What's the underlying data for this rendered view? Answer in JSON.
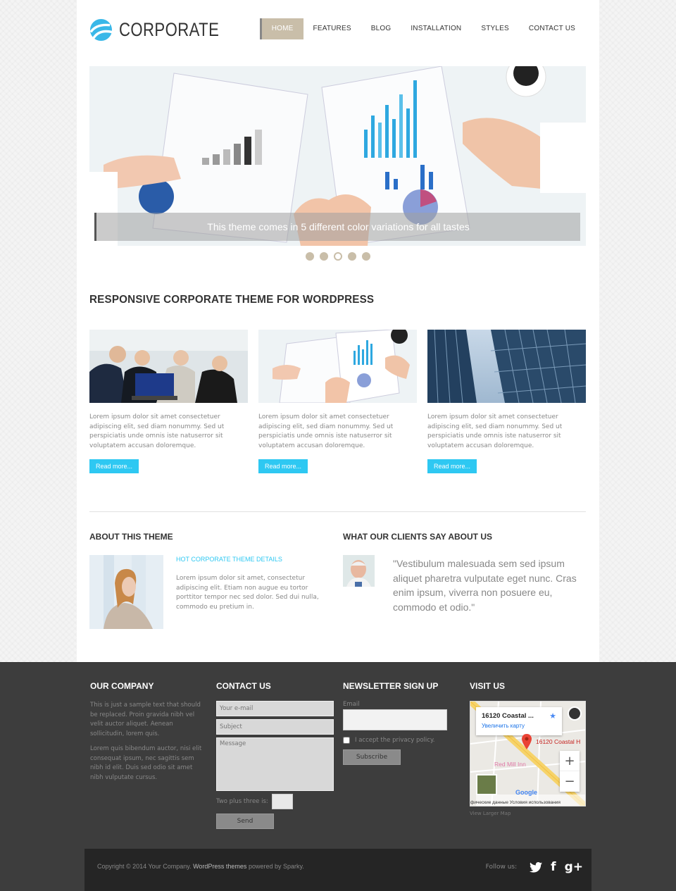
{
  "header": {
    "logo_text": "CORPORATE",
    "nav": [
      {
        "label": "HOME",
        "active": true
      },
      {
        "label": "FEATURES"
      },
      {
        "label": "BLOG"
      },
      {
        "label": "INSTALLATION"
      },
      {
        "label": "STYLES"
      },
      {
        "label": "CONTACT US"
      }
    ]
  },
  "slider": {
    "caption": "This theme comes in 5 different color variations for all tastes",
    "dots_count": 5,
    "active_dot": 3
  },
  "main": {
    "section_title": "RESPONSIVE CORPORATE THEME FOR WORDPRESS",
    "cards": [
      {
        "image": "business-team-laptop-photo",
        "text": "Lorem ipsum dolor sit amet consectetuer adipiscing elit, sed diam nonummy. Sed ut perspiciatis unde omnis iste natuserror sit voluptatem accusan doloremque.",
        "button": "Read more..."
      },
      {
        "image": "financial-charts-photo",
        "text": "Lorem ipsum dolor sit amet consectetuer adipiscing elit, sed diam nonummy. Sed ut perspiciatis unde omnis iste natuserror sit voluptatem accusan doloremque.",
        "button": "Read more..."
      },
      {
        "image": "skyscrapers-photo",
        "text": "Lorem ipsum dolor sit amet consectetuer adipiscing elit, sed diam nonummy. Sed ut perspiciatis unde omnis iste natuserror sit voluptatem accusan doloremque.",
        "button": "Read more..."
      }
    ],
    "about": {
      "title": "ABOUT THIS THEME",
      "subtitle": "HOT CORPORATE THEME DETAILS",
      "text": "Lorem ipsum dolor sit amet, consectetur adipiscing elit. Etiam non augue eu tortor porttitor tempor nec sed dolor. Sed dui nulla, commodo eu pretium in."
    },
    "clients": {
      "title": "WHAT OUR CLIENTS SAY ABOUT US",
      "quote": "\"Vestibulum malesuada sem sed ipsum aliquet pharetra vulputate eget nunc. Cras enim ipsum, viverra non posuere eu, commodo et odio.\""
    }
  },
  "footer": {
    "company": {
      "title": "OUR COMPANY",
      "p1": "This is just a sample text that should be replaced. Proin gravida nibh vel velit auctor aliquet. Aenean sollicitudin, lorem quis.",
      "p2": "Lorem quis bibendum auctor, nisi elit consequat ipsum, nec sagittis sem nibh id elit. Duis sed odio sit amet nibh vulputate cursus."
    },
    "contact": {
      "title": "CONTACT US",
      "email_placeholder": "Your e-mail",
      "subject_placeholder": "Subject",
      "message_placeholder": "Message",
      "captcha_label": "Two plus three is:",
      "captcha_value": "",
      "send_label": "Send"
    },
    "newsletter": {
      "title": "NEWSLETTER SIGN UP",
      "email_label": "Email",
      "email_value": "",
      "privacy_label": "I accept the privacy policy.",
      "privacy_checked": false,
      "subscribe_label": "Subscribe"
    },
    "visit": {
      "title": "VISIT US",
      "map_place": "16120 Coastal ...",
      "map_enlarge": "Увеличить карту",
      "map_pin_label": "16120 Coastal H",
      "map_poi": "Red Mill Inn",
      "map_attribution": "фические данные   Условия использования",
      "map_google": "Google",
      "zoom_in": "+",
      "zoom_out": "−",
      "larger_map": "View Larger Map"
    },
    "bottom": {
      "copyright_prefix": "Copyright © 2014 Your Company.",
      "copyright_link": "WordPress themes",
      "copyright_suffix": "powered by Sparky.",
      "follow_label": "Follow us:",
      "social": [
        "twitter",
        "facebook",
        "google-plus"
      ]
    }
  },
  "colors": {
    "accent": "#2ec8f2",
    "nav_active": "#c9bea9",
    "footer_bg": "#3d3d3d",
    "bottom_bar_bg": "#252525"
  }
}
